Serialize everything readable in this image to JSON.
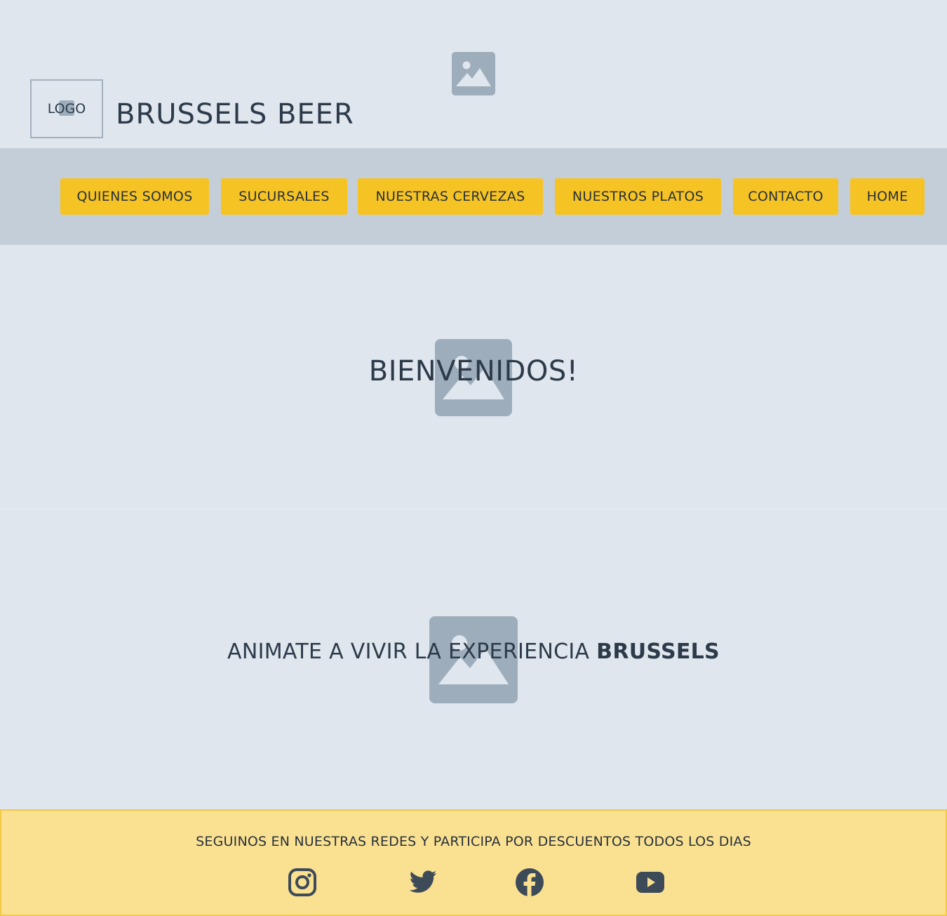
{
  "header": {
    "logo_label": "LOGO",
    "brand_title": "BRUSSELS BEER",
    "image_icon": "image-placeholder-icon"
  },
  "nav": {
    "items": [
      {
        "label": "QUIENES SOMOS"
      },
      {
        "label": "SUCURSALES"
      },
      {
        "label": "NUESTRAS CERVEZAS"
      },
      {
        "label": "NUESTROS PLATOS"
      },
      {
        "label": "CONTACTO"
      },
      {
        "label": "HOME"
      }
    ]
  },
  "hero": {
    "title": "BIENVENIDOS!",
    "image_icon": "image-placeholder-icon"
  },
  "promo": {
    "text_prefix": "ANIMATE A VIVIR LA EXPERIENCIA ",
    "text_bold": "BRUSSELS",
    "image_icon": "image-placeholder-icon"
  },
  "footer": {
    "text": "SEGUINOS EN NUESTRAS REDES Y PARTICIPA POR DESCUENTOS TODOS LOS DIAS",
    "social": [
      {
        "icon": "instagram-icon"
      },
      {
        "icon": "twitter-icon"
      },
      {
        "icon": "facebook-icon"
      },
      {
        "icon": "youtube-icon"
      }
    ]
  },
  "colors": {
    "background": "#dfe6ee",
    "nav_background": "#c3ced9",
    "button": "#f6c325",
    "footer_background": "#fae192",
    "placeholder": "#9eadbb",
    "text": "#2c3a4a"
  }
}
